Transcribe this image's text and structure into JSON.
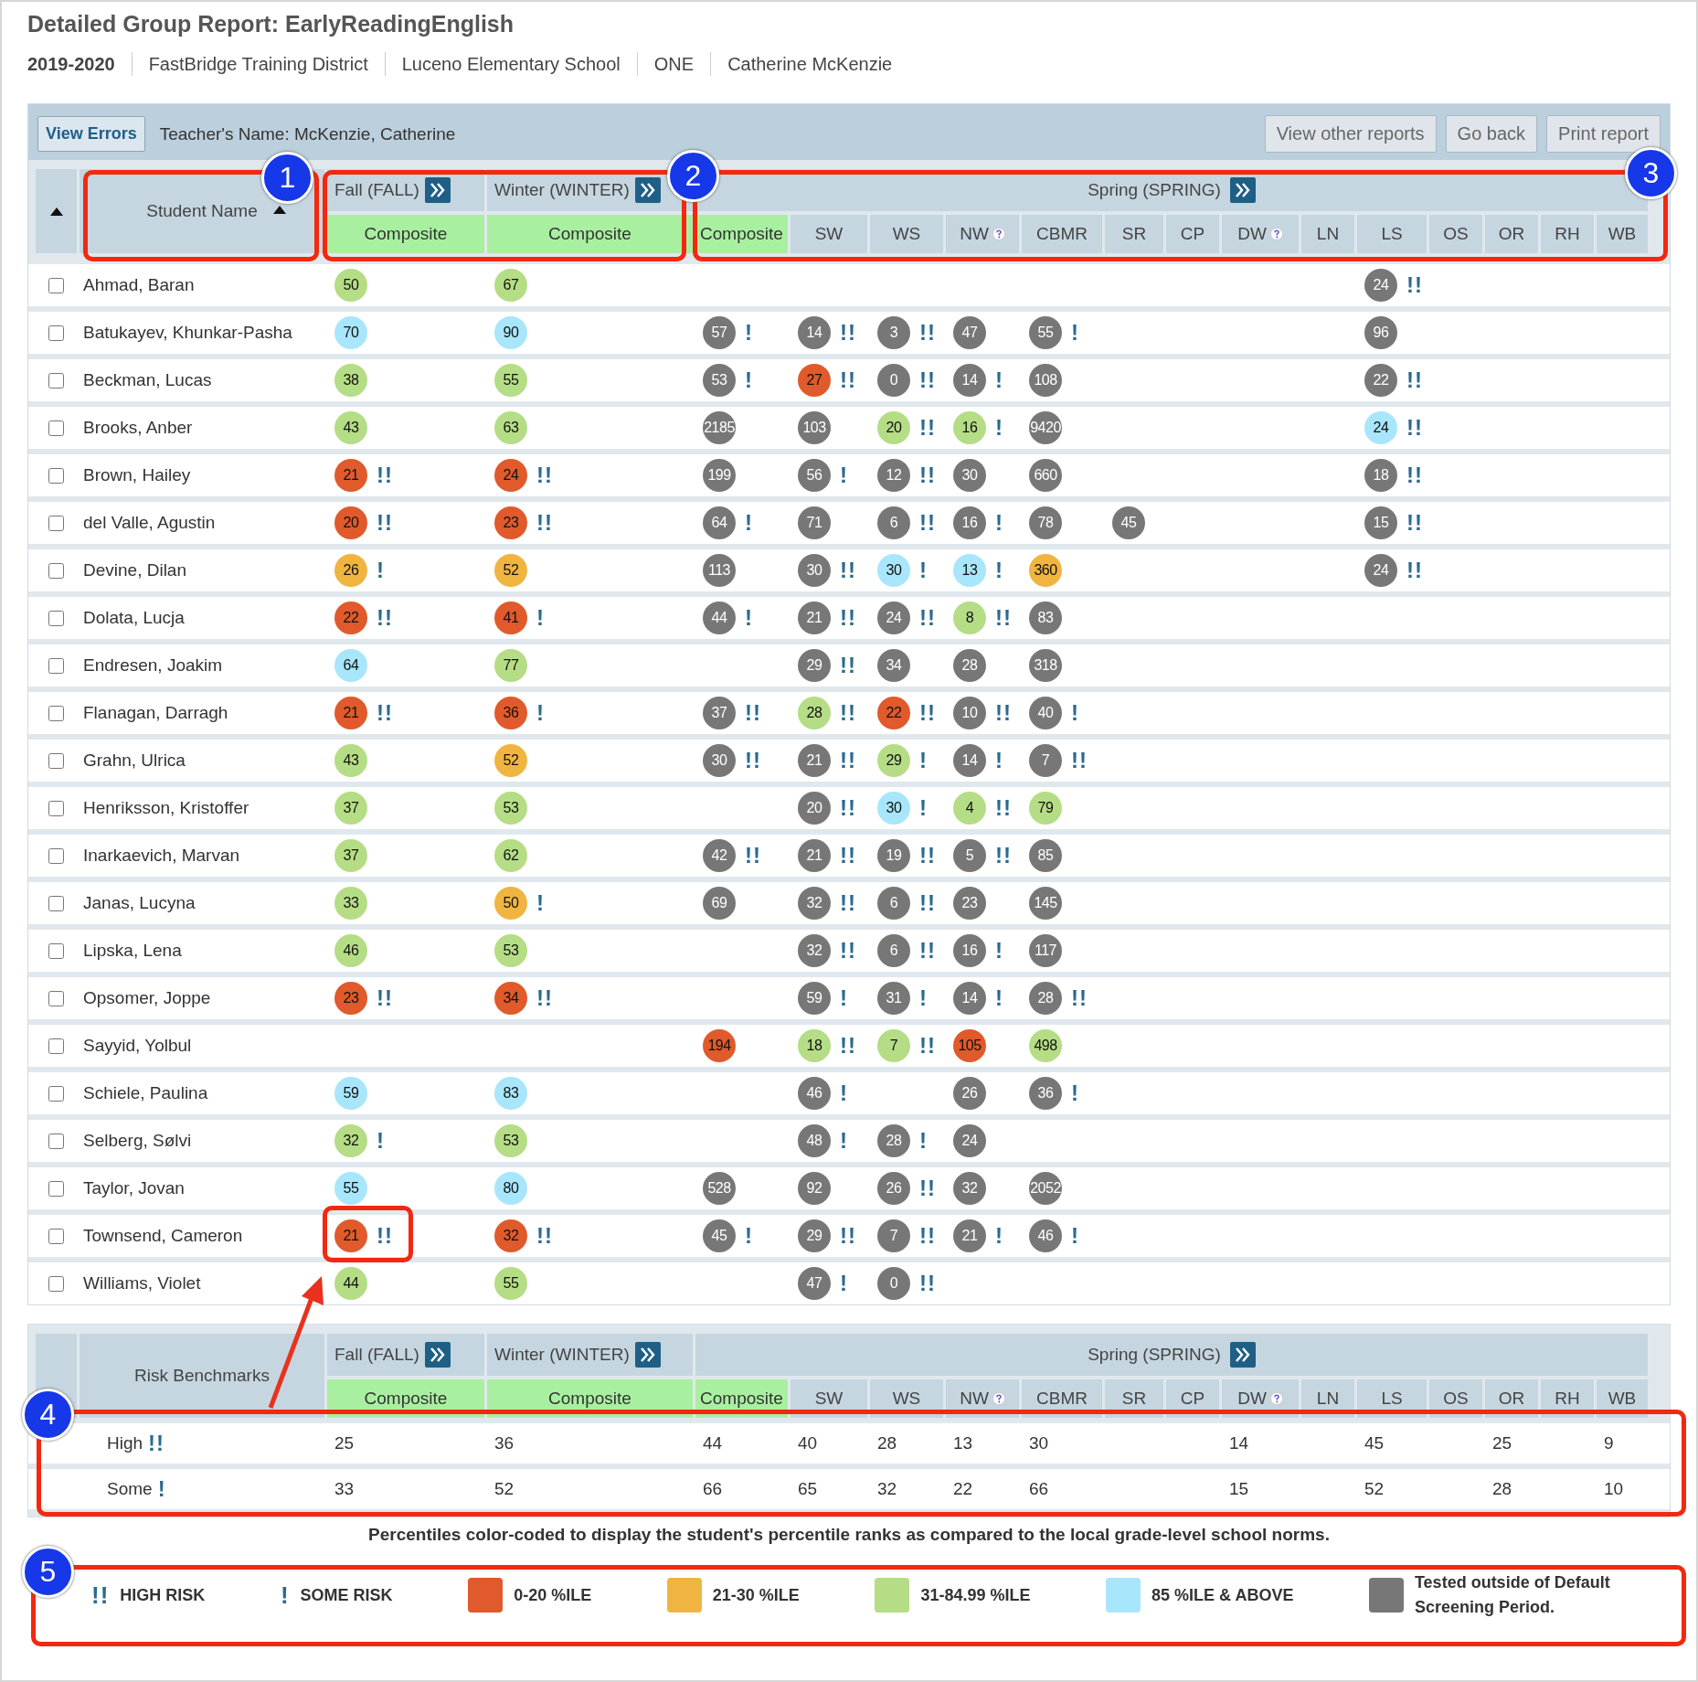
{
  "title": "Detailed Group Report: EarlyReadingEnglish",
  "meta": [
    {
      "text": "2019-2020",
      "bold": true
    },
    {
      "text": "FastBridge Training District",
      "bold": false
    },
    {
      "text": "Luceno Elementary School",
      "bold": false
    },
    {
      "text": "ONE",
      "bold": false
    },
    {
      "text": "Catherine McKenzie",
      "bold": false
    }
  ],
  "toolbar": {
    "view_errors": "View Errors",
    "teacher": "Teacher's Name: McKenzie, Catherine",
    "buttons": [
      "View other reports",
      "Go back",
      "Print report"
    ]
  },
  "table": {
    "name_column": "Student Name",
    "periods": [
      {
        "label": "Fall (FALL)",
        "columns": [
          {
            "label": "Composite",
            "kind": "composite",
            "help": false
          }
        ]
      },
      {
        "label": "Winter (WINTER)",
        "columns": [
          {
            "label": "Composite",
            "kind": "composite",
            "help": false
          }
        ]
      },
      {
        "label": "Spring (SPRING)",
        "columns": [
          {
            "label": "Composite",
            "kind": "composite",
            "help": false
          },
          {
            "label": "SW",
            "kind": "subtest",
            "help": false
          },
          {
            "label": "WS",
            "kind": "subtest",
            "help": false
          },
          {
            "label": "NW",
            "kind": "subtest",
            "help": true
          },
          {
            "label": "CBMR",
            "kind": "subtest",
            "help": false
          },
          {
            "label": "SR",
            "kind": "subtest",
            "help": false
          },
          {
            "label": "CP",
            "kind": "subtest",
            "help": false
          },
          {
            "label": "DW",
            "kind": "subtest",
            "help": true
          },
          {
            "label": "LN",
            "kind": "subtest",
            "help": false
          },
          {
            "label": "LS",
            "kind": "subtest",
            "help": false
          },
          {
            "label": "OS",
            "kind": "subtest",
            "help": false
          },
          {
            "label": "OR",
            "kind": "subtest",
            "help": false
          },
          {
            "label": "RH",
            "kind": "subtest",
            "help": false
          },
          {
            "label": "WB",
            "kind": "subtest",
            "help": false
          }
        ]
      }
    ],
    "rows": [
      {
        "name": "Ahmad, Baran",
        "checked": false,
        "scores": {
          "fall": {
            "value": "50",
            "color": "#b5dd85"
          },
          "winter": {
            "value": "67",
            "color": "#b5dd85"
          },
          "ls": {
            "value": "24",
            "color": "#777777",
            "flag": "!!"
          }
        }
      },
      {
        "name": "Batukayev, Khunkar-Pasha",
        "checked": false,
        "scores": {
          "fall": {
            "value": "70",
            "color": "#a8e6fb"
          },
          "winter": {
            "value": "90",
            "color": "#a8e6fb"
          },
          "composite": {
            "value": "57",
            "color": "#777777",
            "flag": "!"
          },
          "sw": {
            "value": "14",
            "color": "#777777",
            "flag": "!!"
          },
          "ws": {
            "value": "3",
            "color": "#777777",
            "flag": "!!"
          },
          "nw": {
            "value": "47",
            "color": "#777777"
          },
          "cbmr": {
            "value": "55",
            "color": "#777777",
            "flag": "!"
          },
          "ls": {
            "value": "96",
            "color": "#777777"
          }
        }
      },
      {
        "name": "Beckman, Lucas",
        "checked": false,
        "scores": {
          "fall": {
            "value": "38",
            "color": "#b5dd85"
          },
          "winter": {
            "value": "55",
            "color": "#b5dd85"
          },
          "composite": {
            "value": "53",
            "color": "#777777",
            "flag": "!"
          },
          "sw": {
            "value": "27",
            "color": "#e05a2b",
            "flag": "!!"
          },
          "ws": {
            "value": "0",
            "color": "#777777",
            "flag": "!!"
          },
          "nw": {
            "value": "14",
            "color": "#777777",
            "flag": "!"
          },
          "cbmr": {
            "value": "108",
            "color": "#777777"
          },
          "ls": {
            "value": "22",
            "color": "#777777",
            "flag": "!!"
          }
        }
      },
      {
        "name": "Brooks, Anber",
        "checked": false,
        "scores": {
          "fall": {
            "value": "43",
            "color": "#b5dd85"
          },
          "winter": {
            "value": "63",
            "color": "#b5dd85"
          },
          "composite": {
            "value": "2185",
            "color": "#777777"
          },
          "sw": {
            "value": "103",
            "color": "#777777"
          },
          "ws": {
            "value": "20",
            "color": "#b5dd85",
            "flag": "!!"
          },
          "nw": {
            "value": "16",
            "color": "#b5dd85",
            "flag": "!"
          },
          "cbmr": {
            "value": "9420",
            "color": "#777777"
          },
          "ls": {
            "value": "24",
            "color": "#a8e6fb",
            "flag": "!!"
          }
        }
      },
      {
        "name": "Brown, Hailey",
        "checked": false,
        "scores": {
          "fall": {
            "value": "21",
            "color": "#e05a2b",
            "flag": "!!"
          },
          "winter": {
            "value": "24",
            "color": "#e05a2b",
            "flag": "!!"
          },
          "composite": {
            "value": "199",
            "color": "#777777"
          },
          "sw": {
            "value": "56",
            "color": "#777777",
            "flag": "!"
          },
          "ws": {
            "value": "12",
            "color": "#777777",
            "flag": "!!"
          },
          "nw": {
            "value": "30",
            "color": "#777777"
          },
          "cbmr": {
            "value": "660",
            "color": "#777777"
          },
          "ls": {
            "value": "18",
            "color": "#777777",
            "flag": "!!"
          }
        }
      },
      {
        "name": "del Valle, Agustin",
        "checked": false,
        "scores": {
          "fall": {
            "value": "20",
            "color": "#e05a2b",
            "flag": "!!"
          },
          "winter": {
            "value": "23",
            "color": "#e05a2b",
            "flag": "!!"
          },
          "composite": {
            "value": "64",
            "color": "#777777",
            "flag": "!"
          },
          "sw": {
            "value": "71",
            "color": "#777777"
          },
          "ws": {
            "value": "6",
            "color": "#777777",
            "flag": "!!"
          },
          "nw": {
            "value": "16",
            "color": "#777777",
            "flag": "!"
          },
          "cbmr": {
            "value": "78",
            "color": "#777777"
          },
          "sr": {
            "value": "45",
            "color": "#777777"
          },
          "ls": {
            "value": "15",
            "color": "#777777",
            "flag": "!!"
          }
        }
      },
      {
        "name": "Devine, Dilan",
        "checked": false,
        "scores": {
          "fall": {
            "value": "26",
            "color": "#f0b541",
            "flag": "!"
          },
          "winter": {
            "value": "52",
            "color": "#f0b541"
          },
          "composite": {
            "value": "113",
            "color": "#777777"
          },
          "sw": {
            "value": "30",
            "color": "#777777",
            "flag": "!!"
          },
          "ws": {
            "value": "30",
            "color": "#a8e6fb",
            "flag": "!"
          },
          "nw": {
            "value": "13",
            "color": "#a8e6fb",
            "flag": "!"
          },
          "cbmr": {
            "value": "360",
            "color": "#f0b541"
          },
          "ls": {
            "value": "24",
            "color": "#777777",
            "flag": "!!"
          }
        }
      },
      {
        "name": "Dolata, Lucja",
        "checked": false,
        "scores": {
          "fall": {
            "value": "22",
            "color": "#e05a2b",
            "flag": "!!"
          },
          "winter": {
            "value": "41",
            "color": "#e05a2b",
            "flag": "!"
          },
          "composite": {
            "value": "44",
            "color": "#777777",
            "flag": "!"
          },
          "sw": {
            "value": "21",
            "color": "#777777",
            "flag": "!!"
          },
          "ws": {
            "value": "24",
            "color": "#777777",
            "flag": "!!"
          },
          "nw": {
            "value": "8",
            "color": "#b5dd85",
            "flag": "!!"
          },
          "cbmr": {
            "value": "83",
            "color": "#777777"
          }
        }
      },
      {
        "name": "Endresen, Joakim",
        "checked": false,
        "scores": {
          "fall": {
            "value": "64",
            "color": "#a8e6fb"
          },
          "winter": {
            "value": "77",
            "color": "#b5dd85"
          },
          "sw": {
            "value": "29",
            "color": "#777777",
            "flag": "!!"
          },
          "ws": {
            "value": "34",
            "color": "#777777"
          },
          "nw": {
            "value": "28",
            "color": "#777777"
          },
          "cbmr": {
            "value": "318",
            "color": "#777777"
          }
        }
      },
      {
        "name": "Flanagan, Darragh",
        "checked": false,
        "scores": {
          "fall": {
            "value": "21",
            "color": "#e05a2b",
            "flag": "!!"
          },
          "winter": {
            "value": "36",
            "color": "#e05a2b",
            "flag": "!"
          },
          "composite": {
            "value": "37",
            "color": "#777777",
            "flag": "!!"
          },
          "sw": {
            "value": "28",
            "color": "#b5dd85",
            "flag": "!!"
          },
          "ws": {
            "value": "22",
            "color": "#e05a2b",
            "flag": "!!"
          },
          "nw": {
            "value": "10",
            "color": "#777777",
            "flag": "!!"
          },
          "cbmr": {
            "value": "40",
            "color": "#777777",
            "flag": "!"
          }
        }
      },
      {
        "name": "Grahn, Ulrica",
        "checked": false,
        "scores": {
          "fall": {
            "value": "43",
            "color": "#b5dd85"
          },
          "winter": {
            "value": "52",
            "color": "#f0b541"
          },
          "composite": {
            "value": "30",
            "color": "#777777",
            "flag": "!!"
          },
          "sw": {
            "value": "21",
            "color": "#777777",
            "flag": "!!"
          },
          "ws": {
            "value": "29",
            "color": "#b5dd85",
            "flag": "!"
          },
          "nw": {
            "value": "14",
            "color": "#777777",
            "flag": "!"
          },
          "cbmr": {
            "value": "7",
            "color": "#777777",
            "flag": "!!"
          }
        }
      },
      {
        "name": "Henriksson, Kristoffer",
        "checked": false,
        "scores": {
          "fall": {
            "value": "37",
            "color": "#b5dd85"
          },
          "winter": {
            "value": "53",
            "color": "#b5dd85"
          },
          "sw": {
            "value": "20",
            "color": "#777777",
            "flag": "!!"
          },
          "ws": {
            "value": "30",
            "color": "#a8e6fb",
            "flag": "!"
          },
          "nw": {
            "value": "4",
            "color": "#b5dd85",
            "flag": "!!"
          },
          "cbmr": {
            "value": "79",
            "color": "#b5dd85"
          }
        }
      },
      {
        "name": "Inarkaevich, Marvan",
        "checked": false,
        "scores": {
          "fall": {
            "value": "37",
            "color": "#b5dd85"
          },
          "winter": {
            "value": "62",
            "color": "#b5dd85"
          },
          "composite": {
            "value": "42",
            "color": "#777777",
            "flag": "!!"
          },
          "sw": {
            "value": "21",
            "color": "#777777",
            "flag": "!!"
          },
          "ws": {
            "value": "19",
            "color": "#777777",
            "flag": "!!"
          },
          "nw": {
            "value": "5",
            "color": "#777777",
            "flag": "!!"
          },
          "cbmr": {
            "value": "85",
            "color": "#777777"
          }
        }
      },
      {
        "name": "Janas, Lucyna",
        "checked": false,
        "scores": {
          "fall": {
            "value": "33",
            "color": "#b5dd85"
          },
          "winter": {
            "value": "50",
            "color": "#f0b541",
            "flag": "!"
          },
          "composite": {
            "value": "69",
            "color": "#777777"
          },
          "sw": {
            "value": "32",
            "color": "#777777",
            "flag": "!!"
          },
          "ws": {
            "value": "6",
            "color": "#777777",
            "flag": "!!"
          },
          "nw": {
            "value": "23",
            "color": "#777777"
          },
          "cbmr": {
            "value": "145",
            "color": "#777777"
          }
        }
      },
      {
        "name": "Lipska, Lena",
        "checked": false,
        "scores": {
          "fall": {
            "value": "46",
            "color": "#b5dd85"
          },
          "winter": {
            "value": "53",
            "color": "#b5dd85"
          },
          "sw": {
            "value": "32",
            "color": "#777777",
            "flag": "!!"
          },
          "ws": {
            "value": "6",
            "color": "#777777",
            "flag": "!!"
          },
          "nw": {
            "value": "16",
            "color": "#777777",
            "flag": "!"
          },
          "cbmr": {
            "value": "117",
            "color": "#777777"
          }
        }
      },
      {
        "name": "Opsomer, Joppe",
        "checked": false,
        "scores": {
          "fall": {
            "value": "23",
            "color": "#e05a2b",
            "flag": "!!"
          },
          "winter": {
            "value": "34",
            "color": "#e05a2b",
            "flag": "!!"
          },
          "sw": {
            "value": "59",
            "color": "#777777",
            "flag": "!"
          },
          "ws": {
            "value": "31",
            "color": "#777777",
            "flag": "!"
          },
          "nw": {
            "value": "14",
            "color": "#777777",
            "flag": "!"
          },
          "cbmr": {
            "value": "28",
            "color": "#777777",
            "flag": "!!"
          }
        }
      },
      {
        "name": "Sayyid, Yolbul",
        "checked": false,
        "scores": {
          "composite": {
            "value": "194",
            "color": "#e05a2b"
          },
          "sw": {
            "value": "18",
            "color": "#b5dd85",
            "flag": "!!"
          },
          "ws": {
            "value": "7",
            "color": "#b5dd85",
            "flag": "!!"
          },
          "nw": {
            "value": "105",
            "color": "#e05a2b"
          },
          "cbmr": {
            "value": "498",
            "color": "#b5dd85"
          }
        }
      },
      {
        "name": "Schiele, Paulina",
        "checked": false,
        "scores": {
          "fall": {
            "value": "59",
            "color": "#a8e6fb"
          },
          "winter": {
            "value": "83",
            "color": "#a8e6fb"
          },
          "sw": {
            "value": "46",
            "color": "#777777",
            "flag": "!"
          },
          "nw": {
            "value": "26",
            "color": "#777777"
          },
          "cbmr": {
            "value": "36",
            "color": "#777777",
            "flag": "!"
          }
        }
      },
      {
        "name": "Selberg, Sølvi",
        "checked": false,
        "scores": {
          "fall": {
            "value": "32",
            "color": "#b5dd85",
            "flag": "!"
          },
          "winter": {
            "value": "53",
            "color": "#b5dd85"
          },
          "sw": {
            "value": "48",
            "color": "#777777",
            "flag": "!"
          },
          "ws": {
            "value": "28",
            "color": "#777777",
            "flag": "!"
          },
          "nw": {
            "value": "24",
            "color": "#777777"
          }
        }
      },
      {
        "name": "Taylor, Jovan",
        "checked": false,
        "scores": {
          "fall": {
            "value": "55",
            "color": "#a8e6fb"
          },
          "winter": {
            "value": "80",
            "color": "#a8e6fb"
          },
          "composite": {
            "value": "528",
            "color": "#777777"
          },
          "sw": {
            "value": "92",
            "color": "#777777"
          },
          "ws": {
            "value": "26",
            "color": "#777777",
            "flag": "!!"
          },
          "nw": {
            "value": "32",
            "color": "#777777"
          },
          "cbmr": {
            "value": "2052",
            "color": "#777777"
          }
        }
      },
      {
        "name": "Townsend, Cameron",
        "checked": false,
        "scores": {
          "fall": {
            "value": "21",
            "color": "#e05a2b",
            "flag": "!!"
          },
          "winter": {
            "value": "32",
            "color": "#e05a2b",
            "flag": "!!"
          },
          "composite": {
            "value": "45",
            "color": "#777777",
            "flag": "!"
          },
          "sw": {
            "value": "29",
            "color": "#777777",
            "flag": "!!"
          },
          "ws": {
            "value": "7",
            "color": "#777777",
            "flag": "!!"
          },
          "nw": {
            "value": "21",
            "color": "#777777",
            "flag": "!"
          },
          "cbmr": {
            "value": "46",
            "color": "#777777",
            "flag": "!"
          }
        }
      },
      {
        "name": "Williams, Violet",
        "checked": false,
        "scores": {
          "fall": {
            "value": "44",
            "color": "#b5dd85"
          },
          "winter": {
            "value": "55",
            "color": "#b5dd85"
          },
          "sw": {
            "value": "47",
            "color": "#777777",
            "flag": "!"
          },
          "ws": {
            "value": "0",
            "color": "#777777",
            "flag": "!!"
          }
        }
      }
    ]
  },
  "benchmarks": {
    "title": "Risk Benchmarks",
    "periods": [
      {
        "label": "Fall (FALL)",
        "columns": [
          {
            "label": "Composite",
            "kind": "composite",
            "help": false
          }
        ]
      },
      {
        "label": "Winter (WINTER)",
        "columns": [
          {
            "label": "Composite",
            "kind": "composite",
            "help": false
          }
        ]
      },
      {
        "label": "Spring (SPRING)",
        "columns": [
          {
            "label": "Composite",
            "kind": "composite",
            "help": false
          },
          {
            "label": "SW",
            "kind": "subtest",
            "help": false
          },
          {
            "label": "WS",
            "kind": "subtest",
            "help": false
          },
          {
            "label": "NW",
            "kind": "subtest",
            "help": true
          },
          {
            "label": "CBMR",
            "kind": "subtest",
            "help": false
          },
          {
            "label": "SR",
            "kind": "subtest",
            "help": false
          },
          {
            "label": "CP",
            "kind": "subtest",
            "help": false
          },
          {
            "label": "DW",
            "kind": "subtest",
            "help": true
          },
          {
            "label": "LN",
            "kind": "subtest",
            "help": false
          },
          {
            "label": "LS",
            "kind": "subtest",
            "help": false
          },
          {
            "label": "OS",
            "kind": "subtest",
            "help": false
          },
          {
            "label": "OR",
            "kind": "subtest",
            "help": false
          },
          {
            "label": "RH",
            "kind": "subtest",
            "help": false
          },
          {
            "label": "WB",
            "kind": "subtest",
            "help": false
          }
        ]
      }
    ],
    "rows": [
      {
        "label": "High",
        "flag": "!!",
        "values": {
          "fall": "25",
          "winter": "36",
          "composite": "44",
          "sw": "40",
          "ws": "28",
          "nw": "13",
          "cbmr": "30",
          "dw": "14",
          "ls": "45",
          "or": "25",
          "wb": "9"
        }
      },
      {
        "label": "Some",
        "flag": "!",
        "values": {
          "fall": "33",
          "winter": "52",
          "composite": "66",
          "sw": "65",
          "ws": "32",
          "nw": "22",
          "cbmr": "66",
          "dw": "15",
          "ls": "52",
          "or": "28",
          "wb": "10"
        }
      }
    ]
  },
  "footnote": "Percentiles color-coded to display the student's percentile ranks as compared to the local grade-level school norms.",
  "legend": [
    {
      "kind": "flag",
      "mark": "!!",
      "label": "HIGH RISK"
    },
    {
      "kind": "flag",
      "mark": "!",
      "label": "SOME RISK"
    },
    {
      "kind": "swatch",
      "color": "#e05a2b",
      "label": "0-20 %ILE"
    },
    {
      "kind": "swatch",
      "color": "#f0b541",
      "label": "21-30 %ILE"
    },
    {
      "kind": "swatch",
      "color": "#b5dd85",
      "label": "31-84.99 %ILE"
    },
    {
      "kind": "swatch",
      "color": "#a8e6fb",
      "label": "85 %ILE & ABOVE"
    },
    {
      "kind": "swatch",
      "color": "#777777",
      "label": "Tested outside of Default Screening Period."
    }
  ],
  "annotations": [
    "1",
    "2",
    "3",
    "4",
    "5"
  ]
}
